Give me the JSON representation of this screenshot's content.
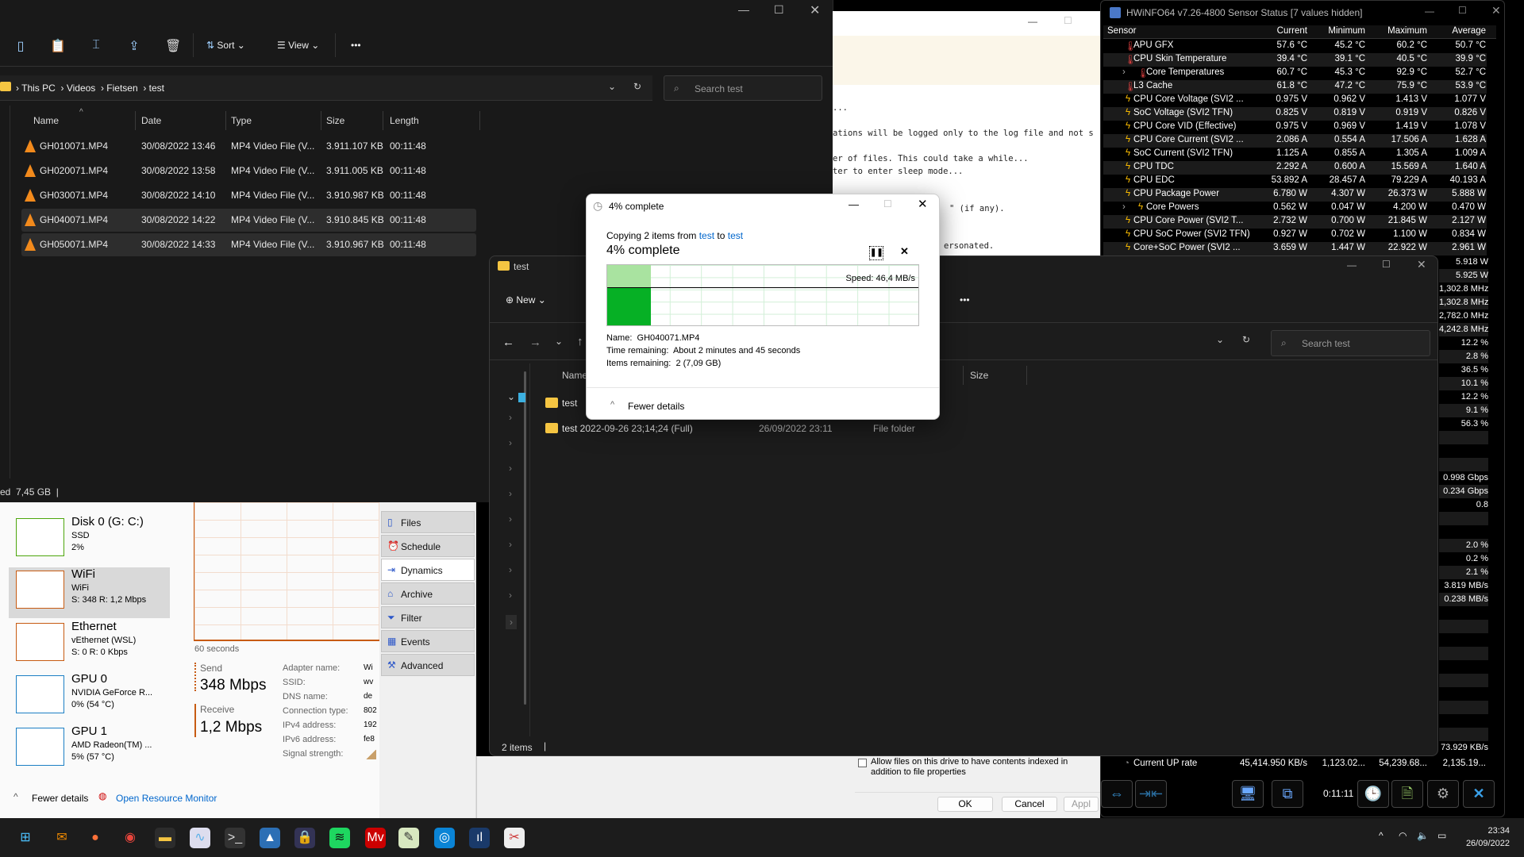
{
  "explorer1": {
    "toolbar": {
      "sort": "Sort",
      "view": "View",
      "more": "•••"
    },
    "breadcrumb": [
      "This PC",
      "Videos",
      "Fietsen",
      "test"
    ],
    "search_placeholder": "Search test",
    "columns": [
      "Name",
      "Date",
      "Type",
      "Size",
      "Length"
    ],
    "rows": [
      {
        "name": "GH010071.MP4",
        "date": "30/08/2022 13:46",
        "type": "MP4 Video File (V...",
        "size": "3.911.107 KB",
        "length": "00:11:48",
        "selected": false
      },
      {
        "name": "GH020071.MP4",
        "date": "30/08/2022 13:58",
        "type": "MP4 Video File (V...",
        "size": "3.911.005 KB",
        "length": "00:11:48",
        "selected": false
      },
      {
        "name": "GH030071.MP4",
        "date": "30/08/2022 14:10",
        "type": "MP4 Video File (V...",
        "size": "3.910.987 KB",
        "length": "00:11:48",
        "selected": false
      },
      {
        "name": "GH040071.MP4",
        "date": "30/08/2022 14:22",
        "type": "MP4 Video File (V...",
        "size": "3.910.845 KB",
        "length": "00:11:48",
        "selected": true
      },
      {
        "name": "GH050071.MP4",
        "date": "30/08/2022 14:33",
        "type": "MP4 Video File (V...",
        "size": "3.910.967 KB",
        "length": "00:11:48",
        "selected": true
      }
    ],
    "status": "ed  7,45 GB"
  },
  "console": {
    "lines": [
      "...",
      "ations will be logged only to the log file and not s",
      "er of files. This could take a while...",
      "ter to enter sleep mode...",
      "\" (if any).",
      "ersonated."
    ]
  },
  "hwinfo": {
    "title": "HWiNFO64 v7.26-4800 Sensor Status [7 values hidden]",
    "columns": [
      "Sensor",
      "Current",
      "Minimum",
      "Maximum",
      "Average"
    ],
    "rows": [
      {
        "icon": "thermometer",
        "name": "APU GFX",
        "cur": "57.6 °C",
        "min": "45.2 °C",
        "max": "60.2 °C",
        "avg": "50.7 °C"
      },
      {
        "icon": "thermometer",
        "name": "CPU Skin Temperature",
        "cur": "39.4 °C",
        "min": "39.1 °C",
        "max": "40.5 °C",
        "avg": "39.9 °C"
      },
      {
        "icon": "thermometer",
        "name": "Core Temperatures",
        "cur": "60.7 °C",
        "min": "45.3 °C",
        "max": "92.9 °C",
        "avg": "52.7 °C",
        "expandable": true
      },
      {
        "icon": "thermometer",
        "name": "L3 Cache",
        "cur": "61.8 °C",
        "min": "47.2 °C",
        "max": "75.9 °C",
        "avg": "53.9 °C"
      },
      {
        "icon": "lightning",
        "name": "CPU Core Voltage (SVI2 ...",
        "cur": "0.975 V",
        "min": "0.962 V",
        "max": "1.413 V",
        "avg": "1.077 V"
      },
      {
        "icon": "lightning",
        "name": "SoC Voltage (SVI2 TFN)",
        "cur": "0.825 V",
        "min": "0.819 V",
        "max": "0.919 V",
        "avg": "0.826 V"
      },
      {
        "icon": "lightning",
        "name": "CPU Core VID (Effective)",
        "cur": "0.975 V",
        "min": "0.969 V",
        "max": "1.419 V",
        "avg": "1.078 V"
      },
      {
        "icon": "lightning",
        "name": "CPU Core Current (SVI2 ...",
        "cur": "2.086 A",
        "min": "0.554 A",
        "max": "17.506 A",
        "avg": "1.628 A"
      },
      {
        "icon": "lightning",
        "name": "SoC Current (SVI2 TFN)",
        "cur": "1.125 A",
        "min": "0.855 A",
        "max": "1.305 A",
        "avg": "1.009 A"
      },
      {
        "icon": "lightning",
        "name": "CPU TDC",
        "cur": "2.292 A",
        "min": "0.600 A",
        "max": "15.569 A",
        "avg": "1.640 A"
      },
      {
        "icon": "lightning",
        "name": "CPU EDC",
        "cur": "53.892 A",
        "min": "28.457 A",
        "max": "79.229 A",
        "avg": "40.193 A"
      },
      {
        "icon": "lightning",
        "name": "CPU Package Power",
        "cur": "6.780 W",
        "min": "4.307 W",
        "max": "26.373 W",
        "avg": "5.888 W"
      },
      {
        "icon": "lightning",
        "name": "Core Powers",
        "cur": "0.562 W",
        "min": "0.047 W",
        "max": "4.200 W",
        "avg": "0.470 W",
        "expandable": true
      },
      {
        "icon": "lightning",
        "name": "CPU Core Power (SVI2 T...",
        "cur": "2.732 W",
        "min": "0.700 W",
        "max": "21.845 W",
        "avg": "2.127 W"
      },
      {
        "icon": "lightning",
        "name": "CPU SoC Power (SVI2 TFN)",
        "cur": "0.927 W",
        "min": "0.702 W",
        "max": "1.100 W",
        "avg": "0.834 W"
      },
      {
        "icon": "lightning",
        "name": "Core+SoC Power (SVI2 ...",
        "cur": "3.659 W",
        "min": "1.447 W",
        "max": "22.922 W",
        "avg": "2.961 W"
      }
    ],
    "average_only": [
      "5.918 W",
      "5.925 W",
      "1,302.8 MHz",
      "1,302.8 MHz",
      "2,782.0 MHz",
      "4,242.8 MHz",
      "12.2 %",
      "2.8 %",
      "36.5 %",
      "10.1 %",
      "12.2 %",
      "9.1 %",
      "56.3 %",
      "",
      "",
      "",
      "0.998 Gbps",
      "0.234 Gbps",
      "0.8",
      "",
      "",
      "2.0 %",
      "0.2 %",
      "2.1 %",
      "3.819 MB/s",
      "0.238 MB/s",
      "",
      "",
      "",
      "",
      "",
      "",
      "",
      "",
      "",
      "",
      "73.929 KB/s"
    ],
    "bottom_row": {
      "name": "Current UP rate",
      "cur": "45,414.950 KB/s",
      "min": "1,123.02...",
      "max": "54,239.68...",
      "avg": "2,135.19..."
    },
    "timer": "0:11:11"
  },
  "explorer2": {
    "title": "test",
    "new_label": "New",
    "more": "•••",
    "search_placeholder": "Search test",
    "columns": {
      "name": "Name",
      "size": "Size"
    },
    "rows": [
      {
        "name": "test",
        "date": "",
        "type": ""
      },
      {
        "name": "test 2022-09-26 23;14;24 (Full)",
        "date": "26/09/2022 23:11",
        "type": "File folder"
      }
    ],
    "status": "2 items"
  },
  "copy_dialog": {
    "title": "4% complete",
    "copying_prefix": "Copying 2 items from ",
    "from": "test",
    "to_word": " to ",
    "to": "test",
    "heading": "4% complete",
    "progress_percent": 4,
    "speed": "Speed: 46,4 MB/s",
    "name_label": "Name:",
    "name_value": "GH040071.MP4",
    "time_label": "Time remaining:",
    "time_value": "About 2 minutes and 45 seconds",
    "items_label": "Items remaining:",
    "items_value": "2 (7,09 GB)",
    "fewer_details": "Fewer details",
    "link_color": "#0066cc",
    "graph_color": "#06b025"
  },
  "task_manager": {
    "items": [
      {
        "title": "Disk 0 (G: C:)",
        "sub": "SSD",
        "value": "2%",
        "color": "#4da60c"
      },
      {
        "title": "WiFi",
        "sub": "WiFi",
        "value": "S: 348 R: 1,2 Mbps",
        "color": "#c75b12",
        "selected": true
      },
      {
        "title": "Ethernet",
        "sub": "vEthernet (WSL)",
        "value": "S: 0 R: 0 Kbps",
        "color": "#c75b12"
      },
      {
        "title": "GPU 0",
        "sub": "NVIDIA GeForce R...",
        "value": "0%  (54 °C)",
        "color": "#1c7fc4"
      },
      {
        "title": "GPU 1",
        "sub": "AMD Radeon(TM) ...",
        "value": "5%  (57 °C)",
        "color": "#1c7fc4"
      }
    ],
    "graph_label": "60 seconds",
    "send_label": "Send",
    "send_value": "348 Mbps",
    "receive_label": "Receive",
    "receive_value": "1,2 Mbps",
    "props": [
      {
        "label": "Adapter name:",
        "value": "Wi"
      },
      {
        "label": "SSID:",
        "value": "wv"
      },
      {
        "label": "DNS name:",
        "value": "de"
      },
      {
        "label": "Connection type:",
        "value": "802"
      },
      {
        "label": "IPv4 address:",
        "value": "192"
      },
      {
        "label": "IPv6 address:",
        "value": "fe8"
      },
      {
        "label": "Signal strength:",
        "value": ""
      }
    ],
    "fewer_details": "Fewer details",
    "resource_monitor": "Open Resource Monitor"
  },
  "side_panel": {
    "items": [
      "Files",
      "Schedule",
      "Dynamics",
      "Archive",
      "Filter",
      "Events",
      "Advanced"
    ],
    "active": "Dynamics"
  },
  "properties_dialog": {
    "checkbox_text": "Allow files on this drive to have contents indexed in addition to",
    "checkbox_text2": "file properties",
    "ok": "OK",
    "cancel": "Cancel",
    "apply": "Appl"
  },
  "taskbar": {
    "apps": [
      "start",
      "mail",
      "firefox",
      "chrome",
      "file-explorer",
      "resource-monitor",
      "terminal",
      "app-bird",
      "vpn",
      "spotify",
      "mv-app",
      "notepad",
      "media",
      "hwinfo",
      "snipping-tool"
    ],
    "time": "23:34",
    "date": "26/09/2022"
  }
}
